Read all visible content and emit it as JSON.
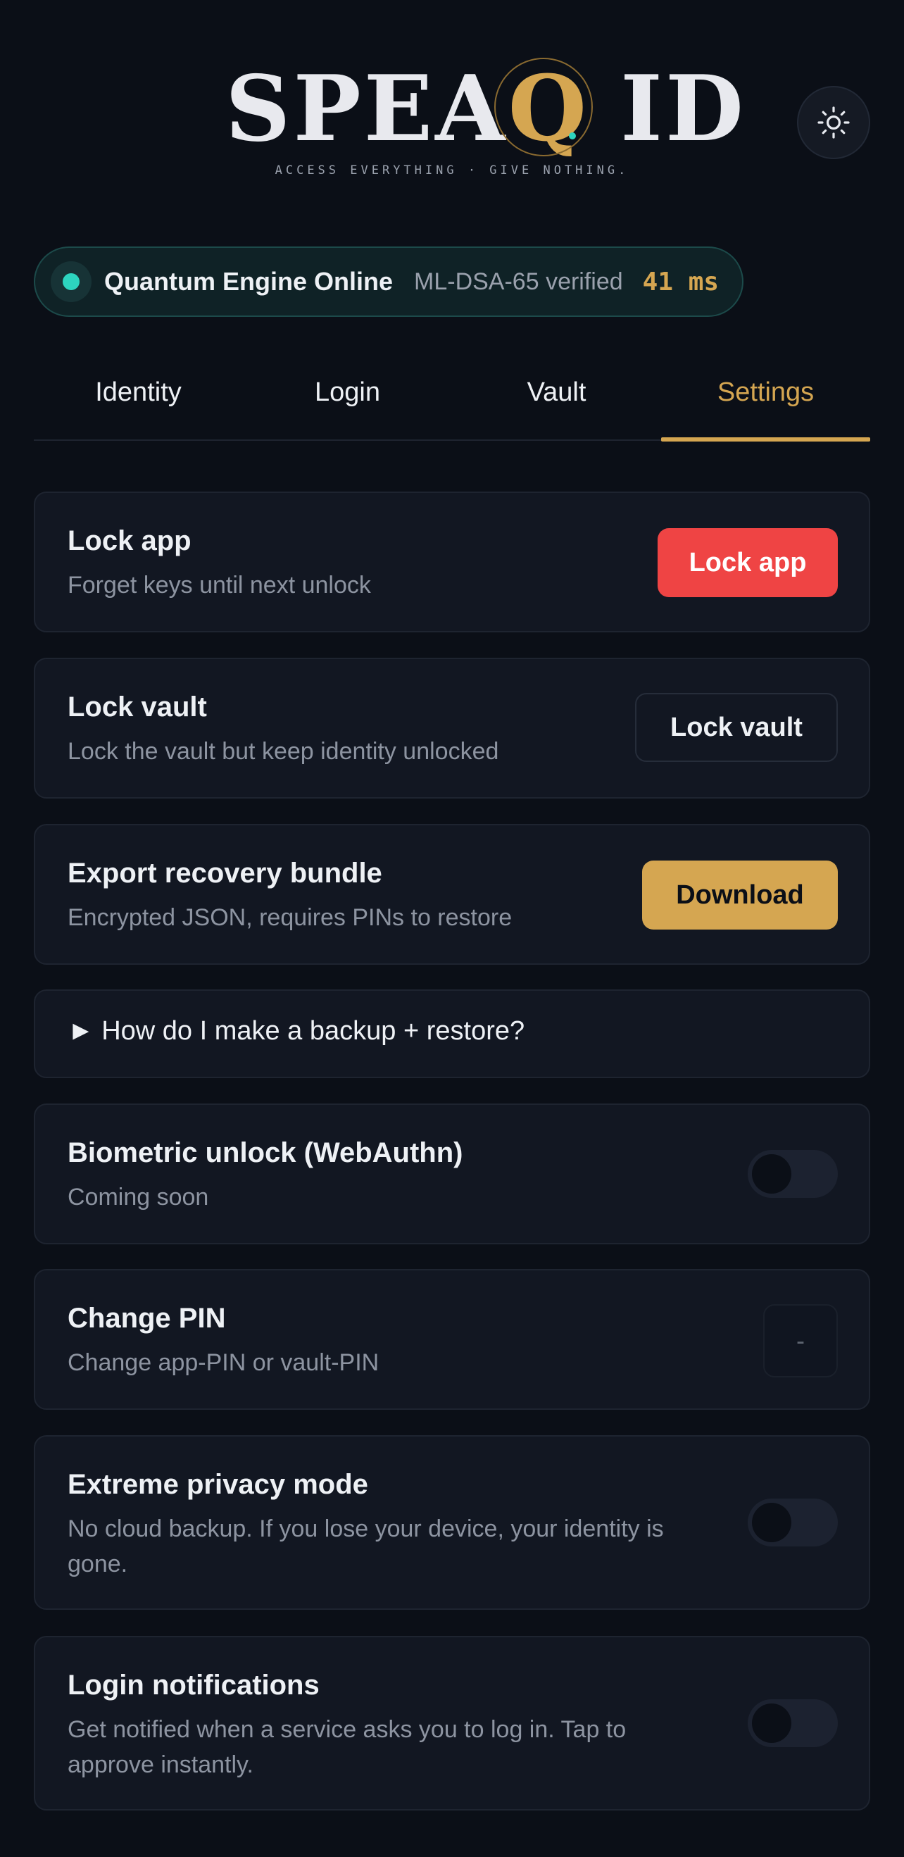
{
  "brand": {
    "logo_part1": "SPEA",
    "logo_q": "Q",
    "logo_part2": "ID",
    "tagline": "ACCESS EVERYTHING · GIVE NOTHING.",
    "accent_gold": "#d5a651",
    "accent_teal": "#2dd4bf"
  },
  "theme_toggle": {
    "icon": "sun-icon"
  },
  "status": {
    "label": "Quantum Engine Online",
    "verified": "ML-DSA-65 verified",
    "latency": "41 ms"
  },
  "tabs": [
    {
      "label": "Identity",
      "active": false
    },
    {
      "label": "Login",
      "active": false
    },
    {
      "label": "Vault",
      "active": false
    },
    {
      "label": "Settings",
      "active": true
    }
  ],
  "settings": {
    "lock_app": {
      "title": "Lock app",
      "desc": "Forget keys until next unlock",
      "button": "Lock app"
    },
    "lock_vault": {
      "title": "Lock vault",
      "desc": "Lock the vault but keep identity unlocked",
      "button": "Lock vault"
    },
    "export": {
      "title": "Export recovery bundle",
      "desc": "Encrypted JSON, requires PINs to restore",
      "button": "Download"
    },
    "faq": {
      "marker": "►",
      "text": "How do I make a backup + restore?"
    },
    "biometric": {
      "title": "Biometric unlock (WebAuthn)",
      "desc": "Coming soon",
      "enabled": false
    },
    "change_pin": {
      "title": "Change PIN",
      "desc": "Change app-PIN or vault-PIN",
      "button": "-"
    },
    "privacy": {
      "title": "Extreme privacy mode",
      "desc": "No cloud backup. If you lose your device, your identity is gone.",
      "enabled": false
    },
    "notifications": {
      "title": "Login notifications",
      "desc": "Get notified when a service asks you to log in. Tap to approve instantly.",
      "enabled": false
    }
  }
}
